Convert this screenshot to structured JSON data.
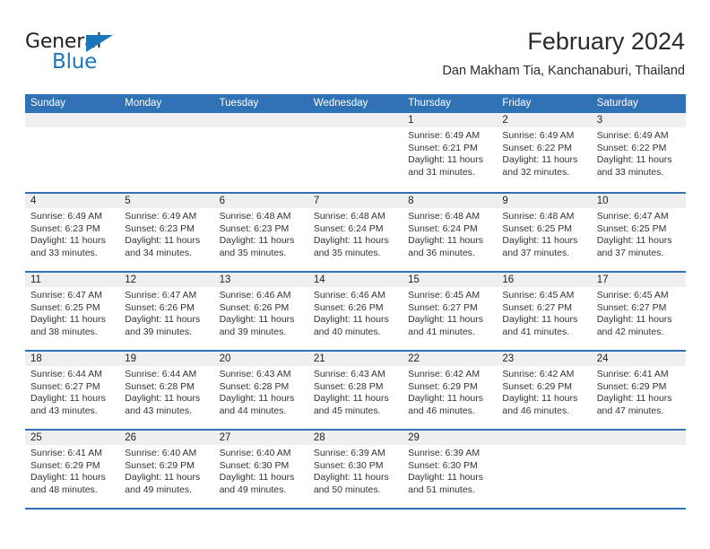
{
  "brand": {
    "word_dark": "General",
    "word_blue": "Blue",
    "triangle_icon": "brand-triangle-icon",
    "colors": {
      "blue": "#1b75bb",
      "dark": "#231f20"
    }
  },
  "header": {
    "title": "February 2024",
    "subtitle": "Dan Makham Tia, Kanchanaburi, Thailand"
  },
  "calendar": {
    "accent_color": "#3072b5",
    "day_band_color": "#efefef",
    "weekdays": [
      "Sunday",
      "Monday",
      "Tuesday",
      "Wednesday",
      "Thursday",
      "Friday",
      "Saturday"
    ],
    "weeks": [
      [
        {
          "day": "",
          "lines": []
        },
        {
          "day": "",
          "lines": []
        },
        {
          "day": "",
          "lines": []
        },
        {
          "day": "",
          "lines": []
        },
        {
          "day": "1",
          "lines": [
            "Sunrise: 6:49 AM",
            "Sunset: 6:21 PM",
            "Daylight: 11 hours",
            "and 31 minutes."
          ]
        },
        {
          "day": "2",
          "lines": [
            "Sunrise: 6:49 AM",
            "Sunset: 6:22 PM",
            "Daylight: 11 hours",
            "and 32 minutes."
          ]
        },
        {
          "day": "3",
          "lines": [
            "Sunrise: 6:49 AM",
            "Sunset: 6:22 PM",
            "Daylight: 11 hours",
            "and 33 minutes."
          ]
        }
      ],
      [
        {
          "day": "4",
          "lines": [
            "Sunrise: 6:49 AM",
            "Sunset: 6:23 PM",
            "Daylight: 11 hours",
            "and 33 minutes."
          ]
        },
        {
          "day": "5",
          "lines": [
            "Sunrise: 6:49 AM",
            "Sunset: 6:23 PM",
            "Daylight: 11 hours",
            "and 34 minutes."
          ]
        },
        {
          "day": "6",
          "lines": [
            "Sunrise: 6:48 AM",
            "Sunset: 6:23 PM",
            "Daylight: 11 hours",
            "and 35 minutes."
          ]
        },
        {
          "day": "7",
          "lines": [
            "Sunrise: 6:48 AM",
            "Sunset: 6:24 PM",
            "Daylight: 11 hours",
            "and 35 minutes."
          ]
        },
        {
          "day": "8",
          "lines": [
            "Sunrise: 6:48 AM",
            "Sunset: 6:24 PM",
            "Daylight: 11 hours",
            "and 36 minutes."
          ]
        },
        {
          "day": "9",
          "lines": [
            "Sunrise: 6:48 AM",
            "Sunset: 6:25 PM",
            "Daylight: 11 hours",
            "and 37 minutes."
          ]
        },
        {
          "day": "10",
          "lines": [
            "Sunrise: 6:47 AM",
            "Sunset: 6:25 PM",
            "Daylight: 11 hours",
            "and 37 minutes."
          ]
        }
      ],
      [
        {
          "day": "11",
          "lines": [
            "Sunrise: 6:47 AM",
            "Sunset: 6:25 PM",
            "Daylight: 11 hours",
            "and 38 minutes."
          ]
        },
        {
          "day": "12",
          "lines": [
            "Sunrise: 6:47 AM",
            "Sunset: 6:26 PM",
            "Daylight: 11 hours",
            "and 39 minutes."
          ]
        },
        {
          "day": "13",
          "lines": [
            "Sunrise: 6:46 AM",
            "Sunset: 6:26 PM",
            "Daylight: 11 hours",
            "and 39 minutes."
          ]
        },
        {
          "day": "14",
          "lines": [
            "Sunrise: 6:46 AM",
            "Sunset: 6:26 PM",
            "Daylight: 11 hours",
            "and 40 minutes."
          ]
        },
        {
          "day": "15",
          "lines": [
            "Sunrise: 6:45 AM",
            "Sunset: 6:27 PM",
            "Daylight: 11 hours",
            "and 41 minutes."
          ]
        },
        {
          "day": "16",
          "lines": [
            "Sunrise: 6:45 AM",
            "Sunset: 6:27 PM",
            "Daylight: 11 hours",
            "and 41 minutes."
          ]
        },
        {
          "day": "17",
          "lines": [
            "Sunrise: 6:45 AM",
            "Sunset: 6:27 PM",
            "Daylight: 11 hours",
            "and 42 minutes."
          ]
        }
      ],
      [
        {
          "day": "18",
          "lines": [
            "Sunrise: 6:44 AM",
            "Sunset: 6:27 PM",
            "Daylight: 11 hours",
            "and 43 minutes."
          ]
        },
        {
          "day": "19",
          "lines": [
            "Sunrise: 6:44 AM",
            "Sunset: 6:28 PM",
            "Daylight: 11 hours",
            "and 43 minutes."
          ]
        },
        {
          "day": "20",
          "lines": [
            "Sunrise: 6:43 AM",
            "Sunset: 6:28 PM",
            "Daylight: 11 hours",
            "and 44 minutes."
          ]
        },
        {
          "day": "21",
          "lines": [
            "Sunrise: 6:43 AM",
            "Sunset: 6:28 PM",
            "Daylight: 11 hours",
            "and 45 minutes."
          ]
        },
        {
          "day": "22",
          "lines": [
            "Sunrise: 6:42 AM",
            "Sunset: 6:29 PM",
            "Daylight: 11 hours",
            "and 46 minutes."
          ]
        },
        {
          "day": "23",
          "lines": [
            "Sunrise: 6:42 AM",
            "Sunset: 6:29 PM",
            "Daylight: 11 hours",
            "and 46 minutes."
          ]
        },
        {
          "day": "24",
          "lines": [
            "Sunrise: 6:41 AM",
            "Sunset: 6:29 PM",
            "Daylight: 11 hours",
            "and 47 minutes."
          ]
        }
      ],
      [
        {
          "day": "25",
          "lines": [
            "Sunrise: 6:41 AM",
            "Sunset: 6:29 PM",
            "Daylight: 11 hours",
            "and 48 minutes."
          ]
        },
        {
          "day": "26",
          "lines": [
            "Sunrise: 6:40 AM",
            "Sunset: 6:29 PM",
            "Daylight: 11 hours",
            "and 49 minutes."
          ]
        },
        {
          "day": "27",
          "lines": [
            "Sunrise: 6:40 AM",
            "Sunset: 6:30 PM",
            "Daylight: 11 hours",
            "and 49 minutes."
          ]
        },
        {
          "day": "28",
          "lines": [
            "Sunrise: 6:39 AM",
            "Sunset: 6:30 PM",
            "Daylight: 11 hours",
            "and 50 minutes."
          ]
        },
        {
          "day": "29",
          "lines": [
            "Sunrise: 6:39 AM",
            "Sunset: 6:30 PM",
            "Daylight: 11 hours",
            "and 51 minutes."
          ]
        },
        {
          "day": "",
          "lines": []
        },
        {
          "day": "",
          "lines": []
        }
      ]
    ]
  }
}
